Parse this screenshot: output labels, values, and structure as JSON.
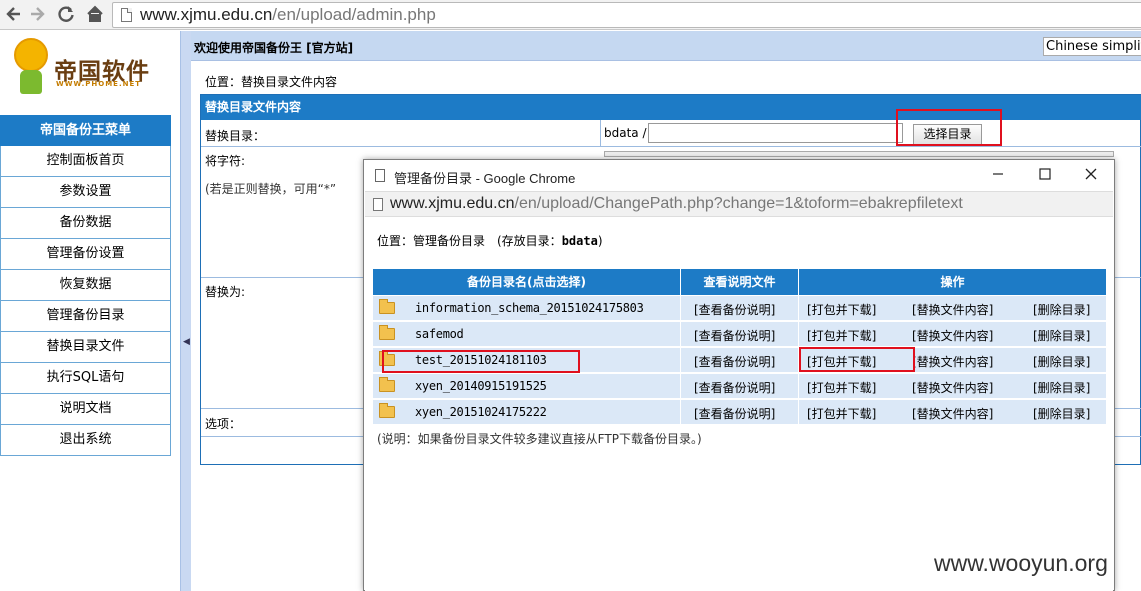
{
  "browser": {
    "url_host": "www.xjmu.edu.cn",
    "url_path": "/en/upload/admin.php",
    "back_icon": "arrow-left-icon",
    "forward_icon": "arrow-right-icon",
    "reload_icon": "reload-icon",
    "home_icon": "home-icon"
  },
  "left": {
    "logo_text": "帝国软件",
    "logo_sub": "WWW.PHOME.NET",
    "menu_title": "帝国备份王菜单",
    "menu_items": [
      "控制面板首页",
      "参数设置",
      "备份数据",
      "管理备份设置",
      "恢复数据",
      "管理备份目录",
      "替换目录文件",
      "执行SQL语句",
      "说明文档",
      "退出系统"
    ]
  },
  "right": {
    "welcome": "欢迎使用帝国备份王 [官方站]",
    "language": "Chinese simplifi",
    "position": "位置：替换目录文件内容",
    "table_title": "替换目录文件内容",
    "label_dir": "替换目录：",
    "bdata_prefix": "bdata /",
    "path_value": "",
    "select_button": "选择目录",
    "label_find": "将字符:",
    "hint": "(若是正则替换，可用“*”",
    "label_replace": "替换为:",
    "label_options": "选项："
  },
  "popup": {
    "title": "管理备份目录 - Google Chrome",
    "url_host": "www.xjmu.edu.cn",
    "url_path": "/en/upload/ChangePath.php?change=1&toform=ebakrepfiletext",
    "position_prefix": "位置：管理备份目录　(存放目录：",
    "position_dir": "bdata",
    "position_suffix": ")",
    "col_name": "备份目录名(点击选择)",
    "col_readme": "查看说明文件",
    "col_ops": "操作",
    "rows": [
      {
        "name": "information_schema_20151024175803",
        "view": "[查看备份说明]",
        "pack": "[打包并下载]",
        "replace": "[替换文件内容]",
        "delete": "[删除目录]"
      },
      {
        "name": "safemod",
        "view": "[查看备份说明]",
        "pack": "[打包并下载]",
        "replace": "[替换文件内容]",
        "delete": "[删除目录]"
      },
      {
        "name": "test_20151024181103",
        "view": "[查看备份说明]",
        "pack": "[打包并下载]",
        "replace": "[替换文件内容]",
        "delete": "[删除目录]"
      },
      {
        "name": "xyen_20140915191525",
        "view": "[查看备份说明]",
        "pack": "[打包并下载]",
        "replace": "[替换文件内容]",
        "delete": "[删除目录]"
      },
      {
        "name": "xyen_20151024175222",
        "view": "[查看备份说明]",
        "pack": "[打包并下载]",
        "replace": "[替换文件内容]",
        "delete": "[删除目录]"
      }
    ],
    "note": "(说明：如果备份目录文件较多建议直接从FTP下载备份目录。)"
  },
  "watermark": "www.wooyun.org",
  "colors": {
    "menu_blue": "#1d7bc6",
    "row_bg": "#dbe8f7",
    "highlight_red": "#e0101e"
  }
}
